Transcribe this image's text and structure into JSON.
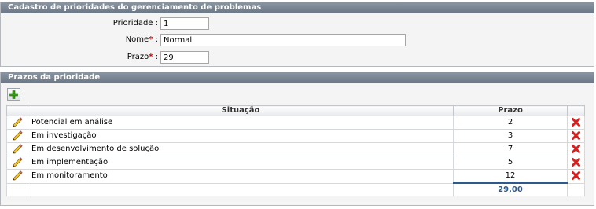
{
  "section1": {
    "title": "Cadastro de prioridades do gerenciamento de problemas",
    "prioridade_label": "Prioridade :",
    "prioridade_value": "1",
    "nome_label": "Nome",
    "nome_value": "Normal",
    "prazo_label": "Prazo",
    "prazo_value": "29",
    "required_mark": "*",
    "colon_sep": ":"
  },
  "section2": {
    "title": "Prazos da prioridade",
    "columns": {
      "situacao": "Situação",
      "prazo": "Prazo"
    },
    "rows": [
      {
        "situacao": "Potencial em análise",
        "prazo": "2"
      },
      {
        "situacao": "Em investigação",
        "prazo": "3"
      },
      {
        "situacao": "Em desenvolvimento de solução",
        "prazo": "7"
      },
      {
        "situacao": "Em implementação",
        "prazo": "5"
      },
      {
        "situacao": "Em monitoramento",
        "prazo": "12"
      }
    ],
    "total": "29,00"
  },
  "icons": {
    "add": "plus-icon",
    "edit": "pencil-icon",
    "delete": "red-x-icon"
  },
  "colors": {
    "header_bar": "#7a8593",
    "required": "#d40000",
    "total_text": "#2c5a8c",
    "add_green": "#3a9a1a",
    "delete_red": "#d81e1e"
  }
}
